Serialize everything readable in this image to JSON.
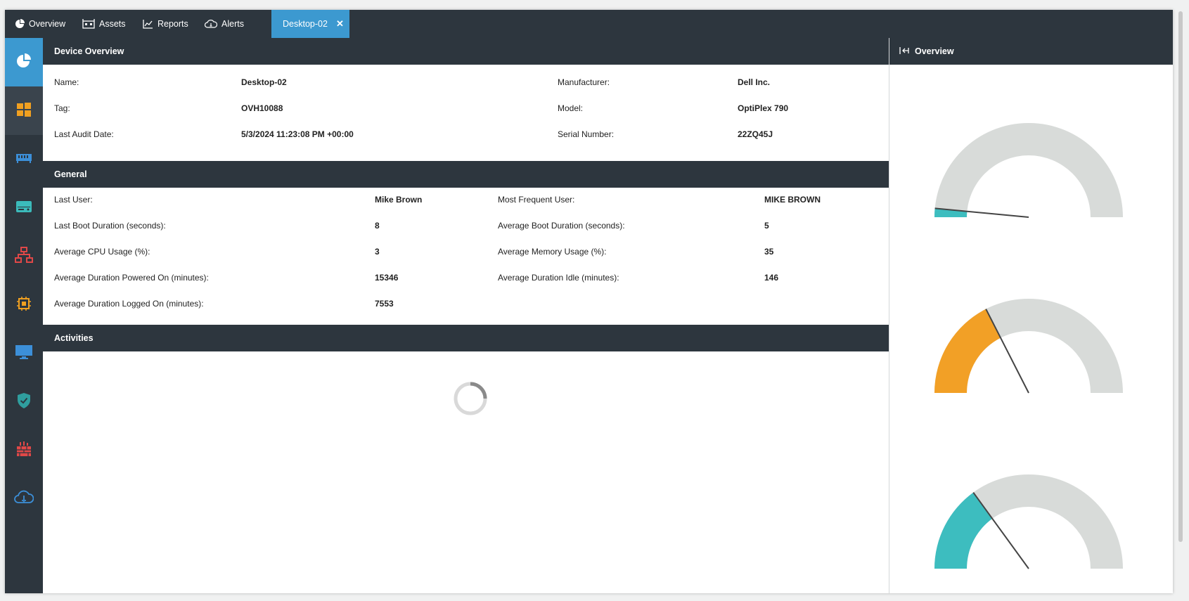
{
  "tabs": [
    {
      "label": "Overview",
      "icon": "pie-chart-icon"
    },
    {
      "label": "Assets",
      "icon": "building-icon"
    },
    {
      "label": "Reports",
      "icon": "line-chart-icon"
    },
    {
      "label": "Alerts",
      "icon": "cloud-bell-icon"
    },
    {
      "label": "Desktop-02",
      "icon": "close-icon",
      "close": "✕"
    }
  ],
  "sidebar": {
    "items": [
      {
        "name": "overview",
        "icon": "pie-chart-icon",
        "color": "#ffffff"
      },
      {
        "name": "windows",
        "icon": "windows-logo-icon",
        "color": "#f0a020"
      },
      {
        "name": "memory",
        "icon": "memory-module-icon",
        "color": "#3c8fd8"
      },
      {
        "name": "storage",
        "icon": "hard-drive-icon",
        "color": "#3bbbbb"
      },
      {
        "name": "network",
        "icon": "network-tree-icon",
        "color": "#e04848"
      },
      {
        "name": "processor",
        "icon": "cpu-chip-icon",
        "color": "#f0a020"
      },
      {
        "name": "display",
        "icon": "monitor-icon",
        "color": "#3c8fd8"
      },
      {
        "name": "security",
        "icon": "shield-check-icon",
        "color": "#2f9e9e"
      },
      {
        "name": "firewall",
        "icon": "firewall-icon",
        "color": "#e04848"
      },
      {
        "name": "alerts",
        "icon": "cloud-bell-icon",
        "color": "#3c8fd8"
      }
    ]
  },
  "device_overview": {
    "title": "Device Overview",
    "rows": [
      {
        "label": "Name:",
        "value": "Desktop-02",
        "label2": "Manufacturer:",
        "value2": "Dell Inc."
      },
      {
        "label": "Tag:",
        "value": "OVH10088",
        "label2": "Model:",
        "value2": "OptiPlex 790"
      },
      {
        "label": "Last Audit Date:",
        "value": "5/3/2024 11:23:08 PM +00:00",
        "label2": "Serial Number:",
        "value2": "22ZQ45J"
      }
    ]
  },
  "general": {
    "title": "General",
    "rows": [
      {
        "label": "Last User:",
        "value": "Mike Brown",
        "label2": "Most Frequent User:",
        "value2": "MIKE BROWN"
      },
      {
        "label": "Last Boot Duration (seconds):",
        "value": "8",
        "label2": "Average Boot Duration (seconds):",
        "value2": "5"
      },
      {
        "label": "Average CPU Usage (%):",
        "value": "3",
        "label2": "Average Memory Usage (%):",
        "value2": "35"
      },
      {
        "label": "Average Duration Powered On (minutes):",
        "value": "15346",
        "label2": "Average Duration Idle (minutes):",
        "value2": "146"
      },
      {
        "label": "Average Duration Logged On (minutes):",
        "value": "7553",
        "label2": "",
        "value2": ""
      }
    ]
  },
  "activities": {
    "title": "Activities",
    "loading": true
  },
  "right_panel": {
    "title": "Overview",
    "icon": "collapse-panel-icon"
  },
  "chart_data": [
    {
      "type": "gauge",
      "value": 3,
      "max": 100,
      "color": "#3dbdbf",
      "track": "#d8dbd9"
    },
    {
      "type": "gauge",
      "value": 35,
      "max": 100,
      "color": "#f2a026",
      "track": "#d8dbd9"
    },
    {
      "type": "gauge",
      "value": 30,
      "max": 100,
      "color": "#3dbdbf",
      "track": "#d8dbd9"
    }
  ],
  "colors": {
    "dark": "#2d363e",
    "accent": "#3c99d0"
  }
}
